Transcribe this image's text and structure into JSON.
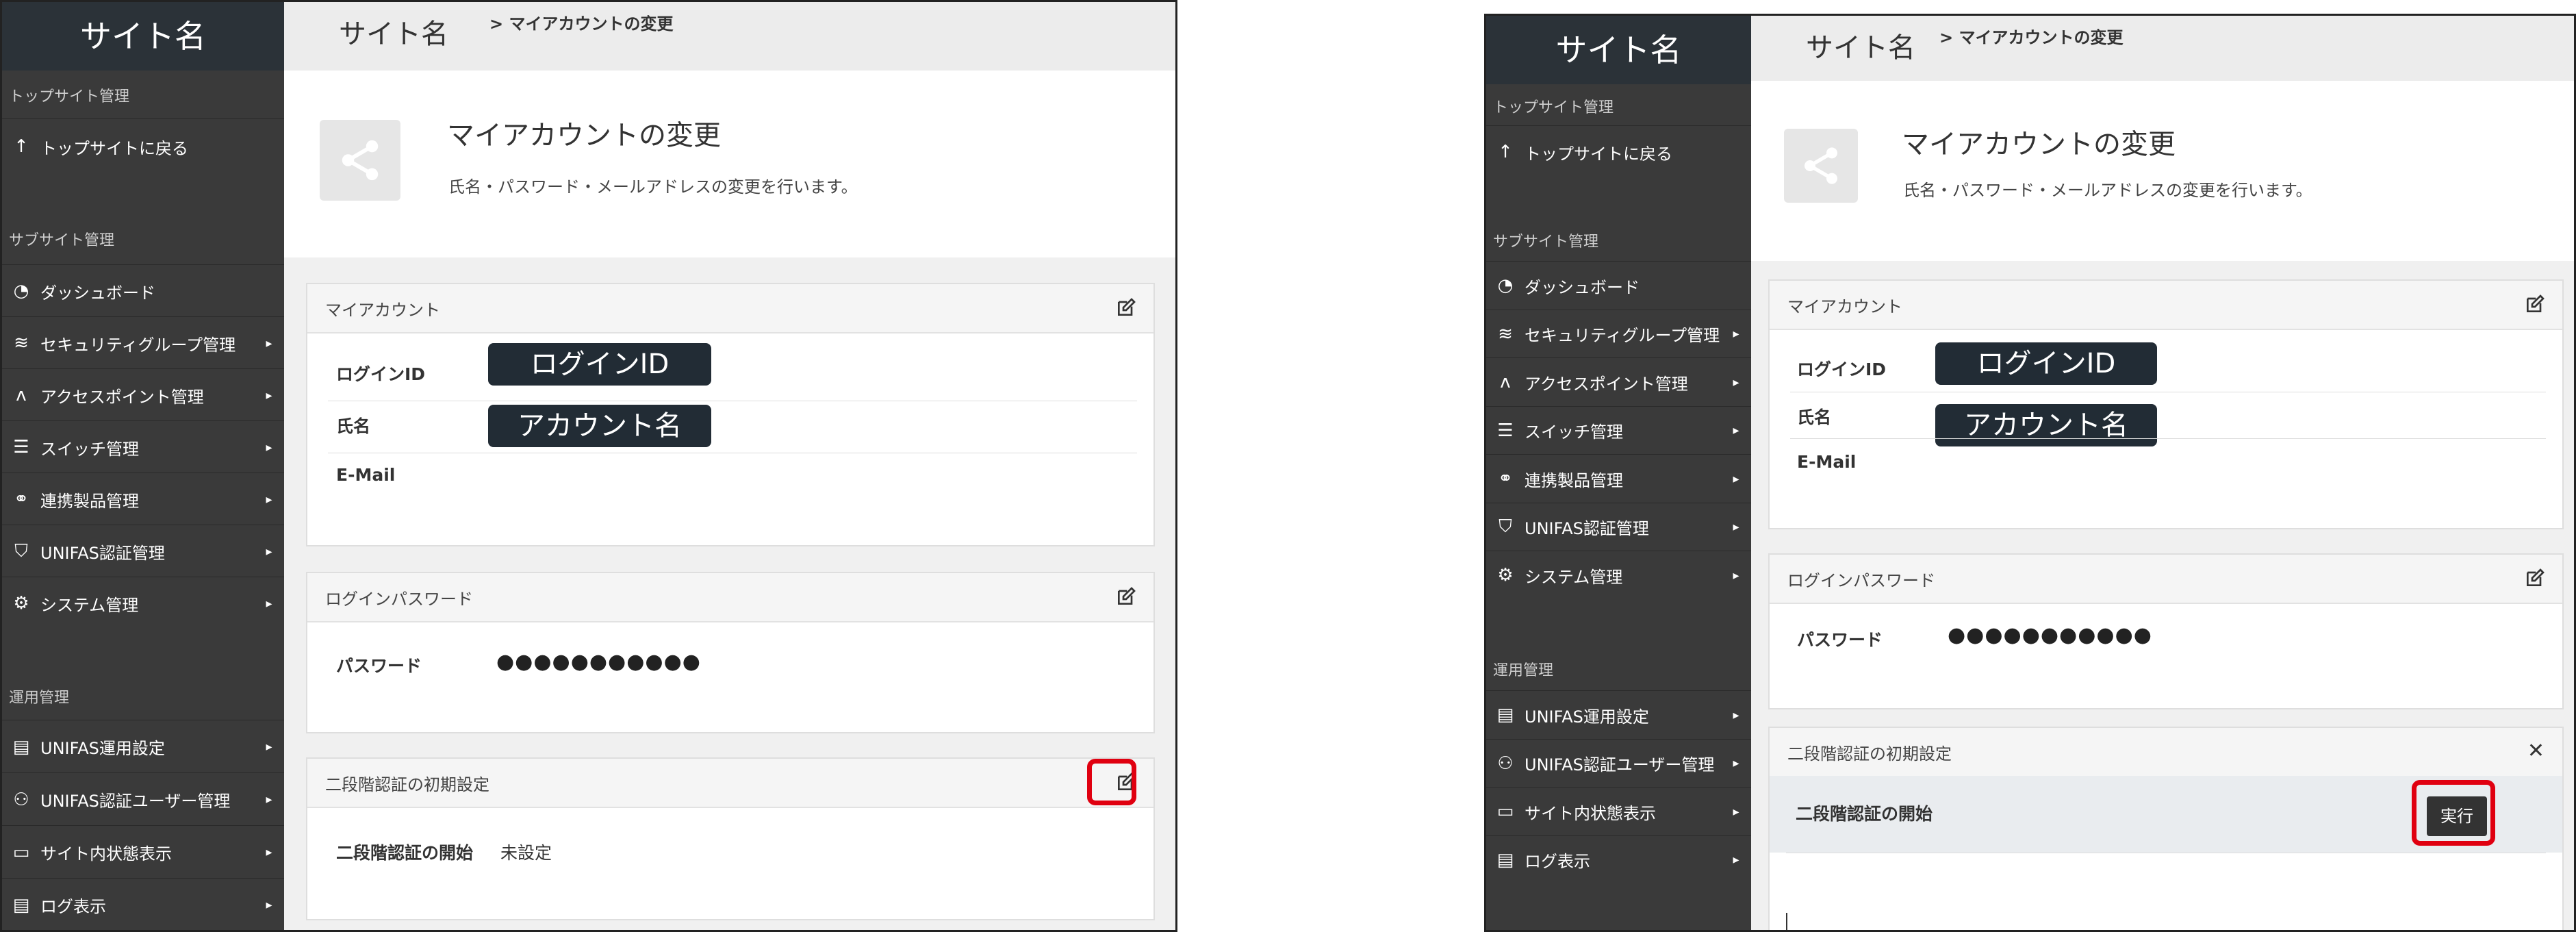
{
  "site_name": "サイト名",
  "breadcrumb": {
    "site": "サイト名",
    "current": "> マイアカウントの変更"
  },
  "sidebar": {
    "top_section": "トップサイト管理",
    "back_item": "トップサイトに戻る",
    "sub_section": "サブサイト管理",
    "sub_items": [
      {
        "icon": "dashboard-icon",
        "label": "ダッシュボード",
        "arrow": ""
      },
      {
        "icon": "wifi-icon",
        "label": "セキュリティグループ管理",
        "arrow": "▸"
      },
      {
        "icon": "antenna-icon",
        "label": "アクセスポイント管理",
        "arrow": "▸"
      },
      {
        "icon": "sliders-icon",
        "label": "スイッチ管理",
        "arrow": "▸"
      },
      {
        "icon": "link-icon",
        "label": "連携製品管理",
        "arrow": "▸"
      },
      {
        "icon": "shield-icon",
        "label": "UNIFAS認証管理",
        "arrow": "▸"
      },
      {
        "icon": "gears-icon",
        "label": "システム管理",
        "arrow": "▸"
      }
    ],
    "ops_section": "運用管理",
    "ops_items": [
      {
        "icon": "server-icon",
        "label": "UNIFAS運用設定",
        "arrow": "▸"
      },
      {
        "icon": "users-icon",
        "label": "UNIFAS認証ユーザー管理",
        "arrow": "▸"
      },
      {
        "icon": "monitor-icon",
        "label": "サイト内状態表示",
        "arrow": "▸"
      },
      {
        "icon": "log-icon",
        "label": "ログ表示",
        "arrow": "▸"
      }
    ]
  },
  "page_header": {
    "title": "マイアカウントの変更",
    "description": "氏名・パスワード・メールアドレスの変更を行います。"
  },
  "my_account": {
    "title": "マイアカウント",
    "login_id_label": "ログインID",
    "login_id_value": "ログインID",
    "name_label": "氏名",
    "name_value": "アカウント名",
    "email_label": "E-Mail",
    "email_value": ""
  },
  "login_password": {
    "title": "ログインパスワード",
    "label": "パスワード",
    "value": "●●●●●●●●●●●"
  },
  "two_factor": {
    "title": "二段階認証の初期設定",
    "label": "二段階認証の開始",
    "status": "未設定",
    "execute_button": "実行",
    "close_symbol": "✕"
  },
  "colors": {
    "sidebar": "#3a3a3a",
    "site_name_bg": "#2b3238",
    "highlight": "#e00010",
    "tag_bg": "#222c35"
  }
}
